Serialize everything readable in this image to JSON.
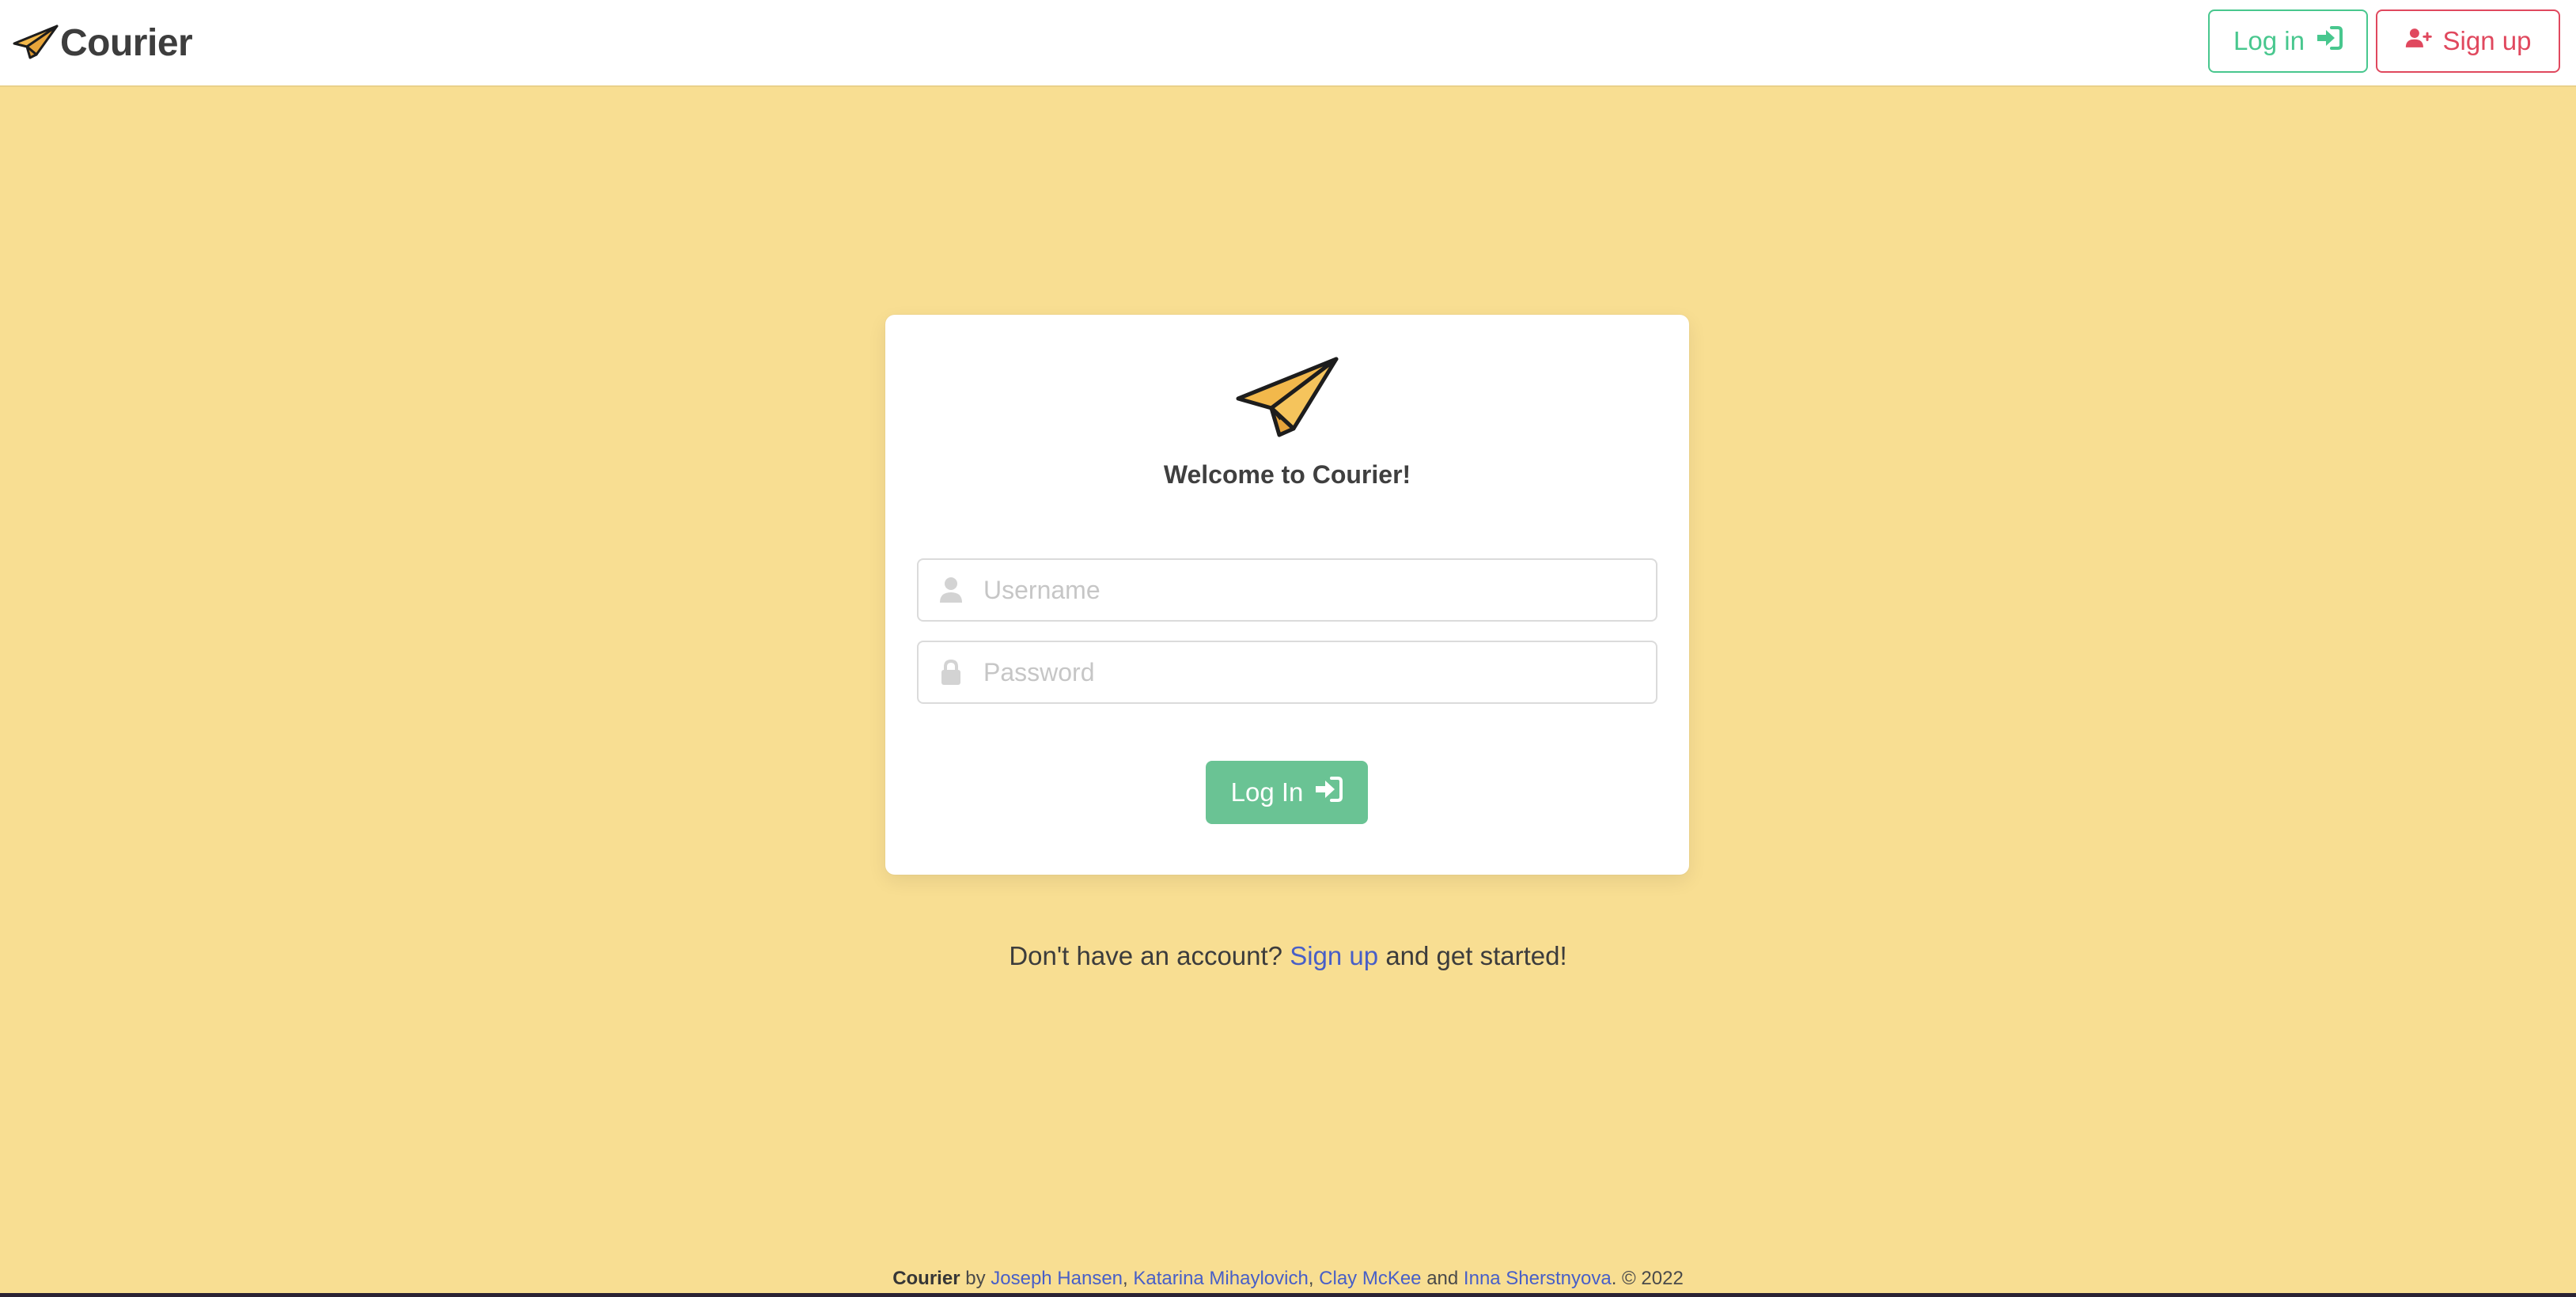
{
  "app": {
    "name": "Courier",
    "logo_icon": "paper-plane-icon"
  },
  "nav": {
    "login_label": "Log in",
    "login_icon": "sign-in-icon",
    "signup_label": "Sign up",
    "signup_icon": "user-plus-icon"
  },
  "login_card": {
    "logo_icon": "paper-plane-icon",
    "welcome": "Welcome to Courier!",
    "username": {
      "placeholder": "Username",
      "value": "",
      "icon": "user-icon"
    },
    "password": {
      "placeholder": "Password",
      "value": "",
      "icon": "lock-icon"
    },
    "submit_label": "Log In",
    "submit_icon": "sign-in-icon"
  },
  "signup_prompt": {
    "before": "Don't have an account?",
    "link": "Sign up",
    "after": "and get started!"
  },
  "footer": {
    "app_name": "Courier",
    "by": "by",
    "authors": [
      "Joseph Hansen",
      "Katarina Mihaylovich",
      "Clay McKee",
      "Inna Sherstnyova"
    ],
    "sep1": ",",
    "sep2": ",",
    "and": "and",
    "copyright": ". © 2022"
  },
  "colors": {
    "background": "#f8de92",
    "login_green": "#48c78e",
    "signup_red": "#e0485e",
    "link_blue": "#485fc7",
    "plane_fill": "#f2b84b"
  }
}
